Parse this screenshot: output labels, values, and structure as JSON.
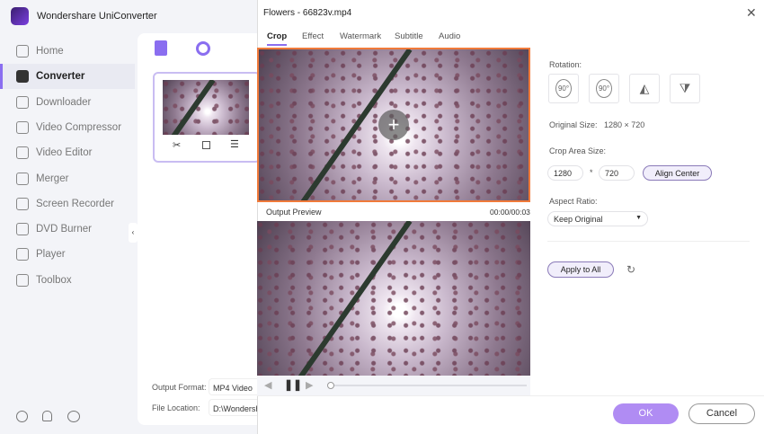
{
  "app": {
    "title": "Wondershare UniConverter"
  },
  "sidebar": {
    "items": [
      {
        "label": "Home",
        "icon": "home-icon"
      },
      {
        "label": "Converter",
        "icon": "converter-icon",
        "active": true
      },
      {
        "label": "Downloader",
        "icon": "download-icon"
      },
      {
        "label": "Video Compressor",
        "icon": "compress-icon"
      },
      {
        "label": "Video Editor",
        "icon": "scissors-icon"
      },
      {
        "label": "Merger",
        "icon": "merge-icon"
      },
      {
        "label": "Screen Recorder",
        "icon": "record-icon"
      },
      {
        "label": "DVD Burner",
        "icon": "disc-icon"
      },
      {
        "label": "Player",
        "icon": "play-icon"
      },
      {
        "label": "Toolbox",
        "icon": "grid-icon"
      }
    ]
  },
  "converter": {
    "output_format_label": "Output Format:",
    "output_format_value": "MP4 Video",
    "file_location_label": "File Location:",
    "file_location_value": "D:\\Wondersh"
  },
  "dialog": {
    "title": "Flowers - 66823v.mp4",
    "tabs": [
      "Crop",
      "Effect",
      "Watermark",
      "Subtitle",
      "Audio"
    ],
    "output_preview_label": "Output Preview",
    "time": "00:00/00:03",
    "rotation_label": "Rotation:",
    "rotate_cw": "90°",
    "rotate_ccw": "90°",
    "original_size_label": "Original Size:",
    "original_size_value": "1280 × 720",
    "crop_area_label": "Crop Area Size:",
    "crop_width": "1280",
    "crop_sep": "*",
    "crop_height": "720",
    "align_center": "Align Center",
    "aspect_ratio_label": "Aspect Ratio:",
    "aspect_ratio_value": "Keep Original",
    "apply_to_all": "Apply to All",
    "ok": "OK",
    "cancel": "Cancel",
    "accent": "#8a6ef0",
    "crop_border": "#f07a3a",
    "playback_progress": 0
  }
}
